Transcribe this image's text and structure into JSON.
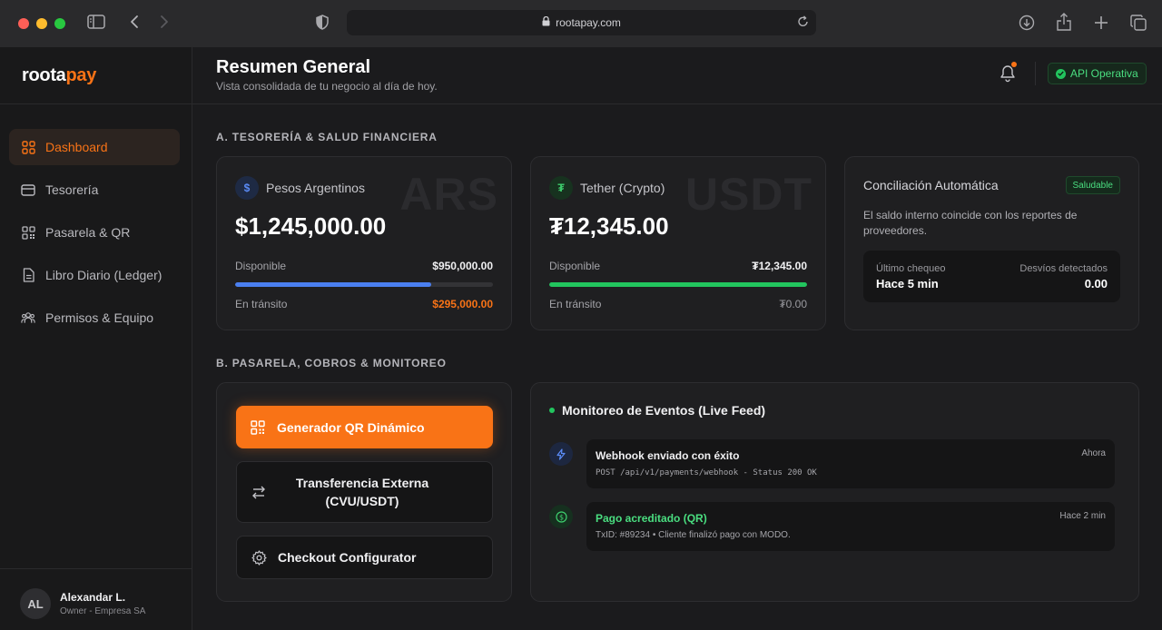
{
  "browser": {
    "url": "rootapay.com"
  },
  "brand": {
    "name_main": "roota",
    "name_accent": "pay"
  },
  "sidebar": {
    "items": [
      {
        "label": "Dashboard",
        "icon": "grid-icon",
        "active": true
      },
      {
        "label": "Tesorería",
        "icon": "card-icon"
      },
      {
        "label": "Pasarela & QR",
        "icon": "qr-icon"
      },
      {
        "label": "Libro Diario (Ledger)",
        "icon": "document-icon"
      },
      {
        "label": "Permisos & Equipo",
        "icon": "users-icon"
      }
    ],
    "user": {
      "initials": "AL",
      "name": "Alexandar L.",
      "role": "Owner - Empresa SA"
    }
  },
  "header": {
    "title": "Resumen General",
    "subtitle": "Vista consolidada de tu negocio al día de hoy.",
    "api_status": "API Operativa"
  },
  "sections": {
    "treasury": "A. TESORERÍA & SALUD FINANCIERA",
    "gateway": "B. PASARELA, COBROS & MONITOREO"
  },
  "ars_card": {
    "symbol": "$",
    "name": "Pesos Argentinos",
    "code": "ARS",
    "total": "$1,245,000.00",
    "available_label": "Disponible",
    "available": "$950,000.00",
    "available_ratio": 0.76,
    "transit_label": "En tránsito",
    "transit": "$295,000.00"
  },
  "usdt_card": {
    "symbol": "₮",
    "name": "Tether (Crypto)",
    "code": "USDT",
    "total": "₮12,345.00",
    "available_label": "Disponible",
    "available": "₮12,345.00",
    "available_ratio": 1.0,
    "transit_label": "En tránsito",
    "transit": "₮0.00"
  },
  "reconciliation": {
    "title": "Conciliación Automática",
    "badge": "Saludable",
    "description": "El saldo interno coincide con los reportes de proveedores.",
    "last_check_label": "Último chequeo",
    "last_check": "Hace 5 min",
    "deviations_label": "Desvíos detectados",
    "deviations": "0.00"
  },
  "actions": {
    "qr": "Generador QR Dinámico",
    "transfer": "Transferencia Externa (CVU/USDT)",
    "checkout": "Checkout Configurator"
  },
  "feed": {
    "title": "Monitoreo de Eventos (Live Feed)",
    "events": [
      {
        "title": "Webhook enviado con éxito",
        "detail": "POST /api/v1/payments/webhook - Status 200 OK",
        "time": "Ahora",
        "icon": "lightning-icon"
      },
      {
        "title": "Pago acreditado (QR)",
        "detail": "TxID: #89234 • Cliente finalizó pago con MODO.",
        "time": "Hace 2 min",
        "icon": "dollar-icon"
      }
    ]
  },
  "colors": {
    "accent": "#f97316",
    "ars_bar": "#4a7ff0",
    "usdt_bar": "#22c55e",
    "transit_orange": "#f97316",
    "success_green": "#4ade80"
  }
}
